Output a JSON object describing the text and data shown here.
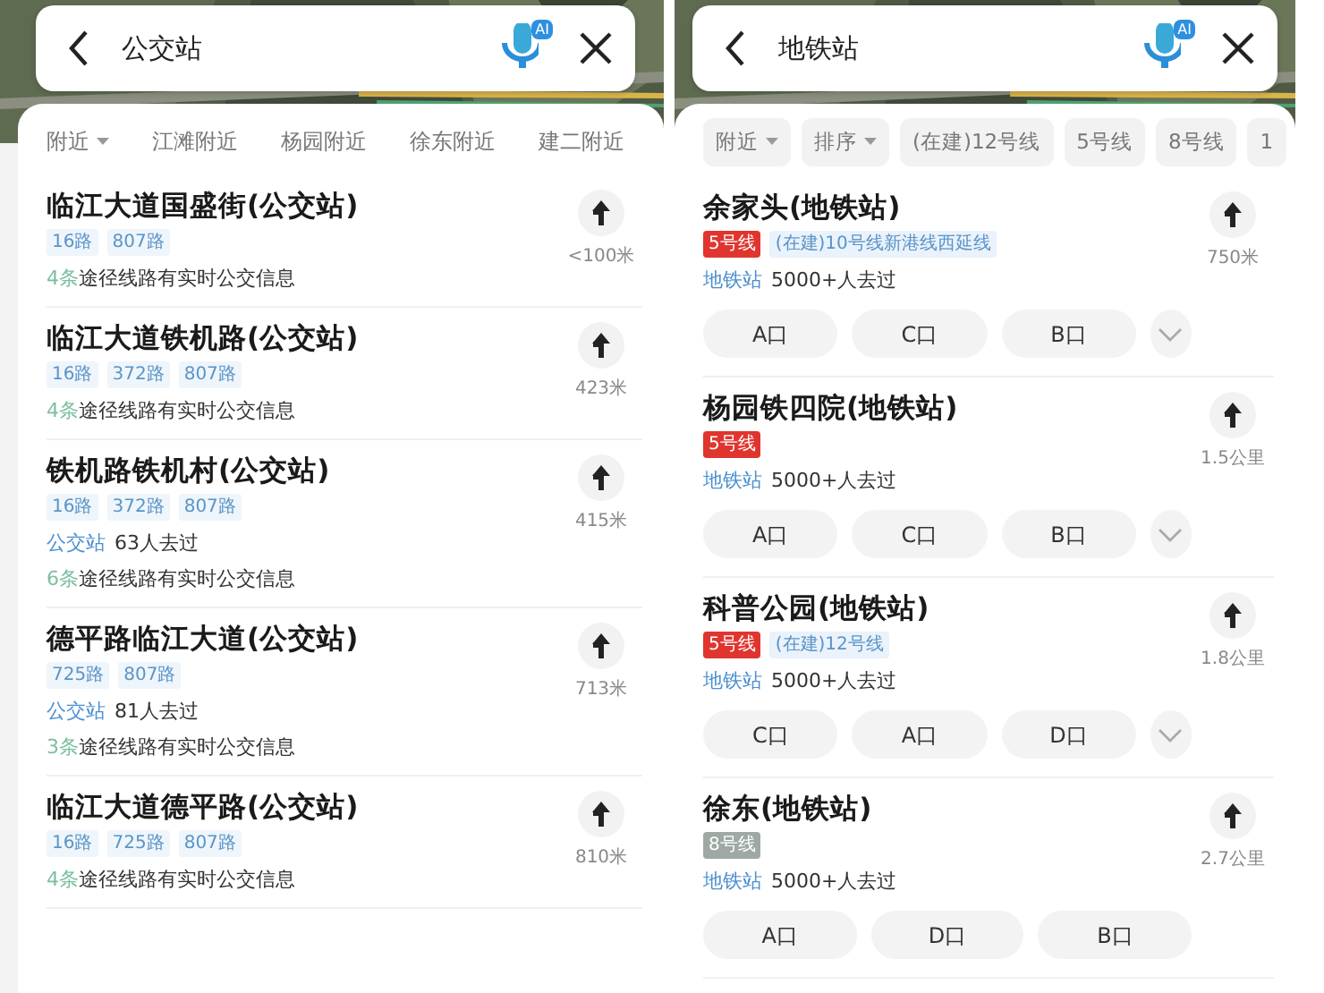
{
  "panels": [
    {
      "kind": "bus",
      "search": {
        "query": "公交站",
        "ai_badge": "AI"
      },
      "filters": [
        {
          "label": "附近",
          "dropdown": true
        },
        {
          "label": "江滩附近",
          "dropdown": false
        },
        {
          "label": "杨园附近",
          "dropdown": false
        },
        {
          "label": "徐东附近",
          "dropdown": false
        },
        {
          "label": "建二附近",
          "dropdown": false
        }
      ],
      "results": [
        {
          "name": "临江大道国盛街(公交站)",
          "tags": [
            {
              "label": "16路",
              "kind": "route"
            },
            {
              "label": "807路",
              "kind": "route"
            }
          ],
          "realtime_count": "4条",
          "realtime_text": "途径线路有实时公交信息",
          "distance": "<100米"
        },
        {
          "name": "临江大道铁机路(公交站)",
          "tags": [
            {
              "label": "16路",
              "kind": "route"
            },
            {
              "label": "372路",
              "kind": "route"
            },
            {
              "label": "807路",
              "kind": "route"
            }
          ],
          "realtime_count": "4条",
          "realtime_text": "途径线路有实时公交信息",
          "distance": "423米"
        },
        {
          "name": "铁机路铁机村(公交站)",
          "tags": [
            {
              "label": "16路",
              "kind": "route"
            },
            {
              "label": "372路",
              "kind": "route"
            },
            {
              "label": "807路",
              "kind": "route"
            }
          ],
          "category": "公交站",
          "visits": "63人去过",
          "realtime_count": "6条",
          "realtime_text": "途径线路有实时公交信息",
          "distance": "415米"
        },
        {
          "name": "德平路临江大道(公交站)",
          "tags": [
            {
              "label": "725路",
              "kind": "route"
            },
            {
              "label": "807路",
              "kind": "route"
            }
          ],
          "category": "公交站",
          "visits": "81人去过",
          "realtime_count": "3条",
          "realtime_text": "途径线路有实时公交信息",
          "distance": "713米"
        },
        {
          "name": "临江大道德平路(公交站)",
          "tags": [
            {
              "label": "16路",
              "kind": "route"
            },
            {
              "label": "725路",
              "kind": "route"
            },
            {
              "label": "807路",
              "kind": "route"
            }
          ],
          "realtime_count": "4条",
          "realtime_text": "途径线路有实时公交信息",
          "distance": "810米"
        }
      ]
    },
    {
      "kind": "metro",
      "search": {
        "query": "地铁站",
        "ai_badge": "AI"
      },
      "filters": [
        {
          "label": "附近",
          "dropdown": true
        },
        {
          "label": "排序",
          "dropdown": true
        },
        {
          "label": "(在建)12号线",
          "dropdown": false
        },
        {
          "label": "5号线",
          "dropdown": false
        },
        {
          "label": "8号线",
          "dropdown": false
        },
        {
          "label": "1",
          "dropdown": false
        }
      ],
      "results": [
        {
          "name": "余家头(地铁站)",
          "tags": [
            {
              "label": "5号线",
              "kind": "line",
              "color": "#e0352f"
            },
            {
              "label": "(在建)10号线新港线西延线",
              "kind": "planned"
            }
          ],
          "category": "地铁站",
          "visits": "5000+人去过",
          "distance": "750米",
          "exits": [
            "A口",
            "C口",
            "B口"
          ],
          "expandable": true
        },
        {
          "name": "杨园铁四院(地铁站)",
          "tags": [
            {
              "label": "5号线",
              "kind": "line",
              "color": "#e0352f"
            }
          ],
          "category": "地铁站",
          "visits": "5000+人去过",
          "distance": "1.5公里",
          "exits": [
            "A口",
            "C口",
            "B口"
          ],
          "expandable": true
        },
        {
          "name": "科普公园(地铁站)",
          "tags": [
            {
              "label": "5号线",
              "kind": "line",
              "color": "#e0352f"
            },
            {
              "label": "(在建)12号线",
              "kind": "planned"
            }
          ],
          "category": "地铁站",
          "visits": "5000+人去过",
          "distance": "1.8公里",
          "exits": [
            "C口",
            "A口",
            "D口"
          ],
          "expandable": true
        },
        {
          "name": "徐东(地铁站)",
          "tags": [
            {
              "label": "8号线",
              "kind": "line",
              "color": "#9fa9a4"
            }
          ],
          "category": "地铁站",
          "visits": "5000+人去过",
          "distance": "2.7公里",
          "exits": [
            "A口",
            "D口",
            "B口"
          ]
        }
      ]
    }
  ]
}
